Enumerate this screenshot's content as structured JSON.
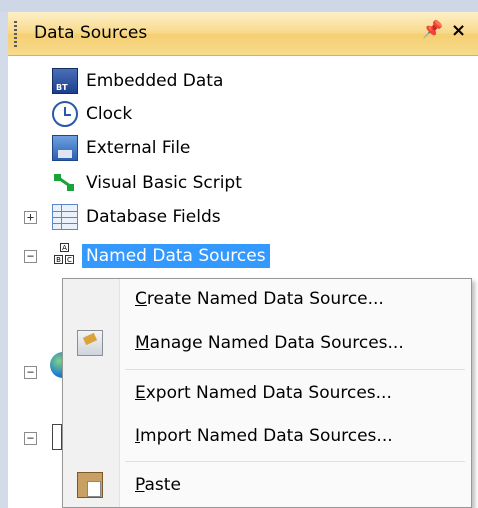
{
  "panel": {
    "title": "Data Sources",
    "pin_glyph": "ઇ",
    "close_glyph": "×"
  },
  "tree": {
    "items": [
      {
        "label": "Embedded Data",
        "icon": "embedded-data-icon"
      },
      {
        "label": "Clock",
        "icon": "clock-icon"
      },
      {
        "label": "External File",
        "icon": "external-file-icon"
      },
      {
        "label": "Visual Basic Script",
        "icon": "vbscript-icon"
      },
      {
        "label": "Database Fields",
        "icon": "database-icon",
        "expander": "+"
      },
      {
        "label": "Named Data Sources",
        "icon": "named-data-sources-icon",
        "expander": "−",
        "selected": true
      }
    ],
    "hidden_expanders": [
      "−",
      "−"
    ]
  },
  "context_menu": {
    "items": [
      {
        "label_pre": "",
        "accel": "C",
        "label_post": "reate Named Data Source...",
        "icon": ""
      },
      {
        "label_pre": "",
        "accel": "M",
        "label_post": "anage Named Data Sources...",
        "icon": "manage-icon"
      },
      {
        "label_pre": "",
        "accel": "E",
        "label_post": "xport Named Data Sources...",
        "icon": ""
      },
      {
        "label_pre": "",
        "accel": "I",
        "label_post": "mport Named Data Sources...",
        "icon": ""
      },
      {
        "label_pre": "",
        "accel": "P",
        "label_post": "aste",
        "icon": "paste-icon"
      }
    ]
  }
}
